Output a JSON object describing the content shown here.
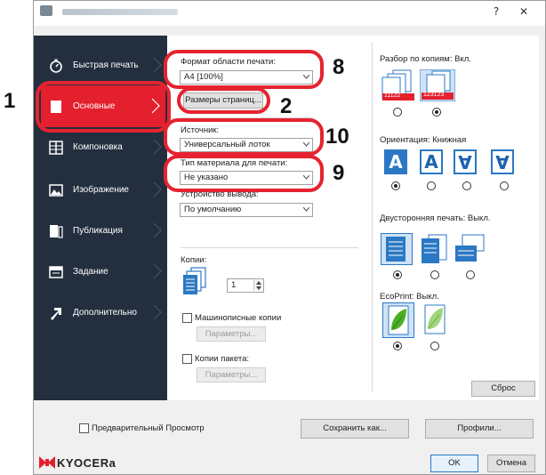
{
  "window": {
    "help_glyph": "?",
    "close_glyph": "✕"
  },
  "sidebar": {
    "items": [
      {
        "label": "Быстрая печать"
      },
      {
        "label": "Основные"
      },
      {
        "label": "Компоновка"
      },
      {
        "label": "Изображение"
      },
      {
        "label": "Публикация"
      },
      {
        "label": "Задание"
      },
      {
        "label": "Дополнительно"
      }
    ]
  },
  "main": {
    "print_size_label": "Формат области печати:",
    "print_size_value": "A4  [100%]",
    "page_sizes_button": "Размеры страниц...",
    "source_label": "Источник:",
    "source_value": "Универсальный лоток",
    "media_type_label": "Тип материала для печати:",
    "media_type_value": "Не указано",
    "output_label": "Устройство вывода:",
    "output_value": "По умолчанию",
    "copies_label": "Копии:",
    "copies_value": "1",
    "typewritten_copies_label": "Машинописные копии",
    "typewritten_params_button": "Параметры...",
    "job_copies_label": "Копии пакета:",
    "job_params_button": "Параметры..."
  },
  "right": {
    "collate_label": "Разбор по копиям:  Вкл.",
    "collate_icon_a": "11122",
    "collate_icon_b": "123123",
    "orientation_label": "Ориентация:  Книжная",
    "orientation_glyph": "A",
    "duplex_label": "Двусторонняя печать:  Выкл.",
    "ecoprint_label": "EcoPrint:  Выкл.",
    "reset_button": "Сброс"
  },
  "callouts": {
    "n1": "1",
    "n2": "2",
    "n8": "8",
    "n9": "9",
    "n10": "10"
  },
  "footer": {
    "preview_label": "Предварительный Просмотр",
    "save_as_button": "Сохранить как...",
    "profiles_button": "Профили...",
    "ok_button": "OK",
    "cancel_button": "Отмена",
    "brand": "KYOCERa"
  },
  "colors": {
    "sidebar_bg": "#232f3e",
    "active_item": "#e4202e",
    "callout": "#e52330",
    "accent_blue": "#2b78c4"
  }
}
